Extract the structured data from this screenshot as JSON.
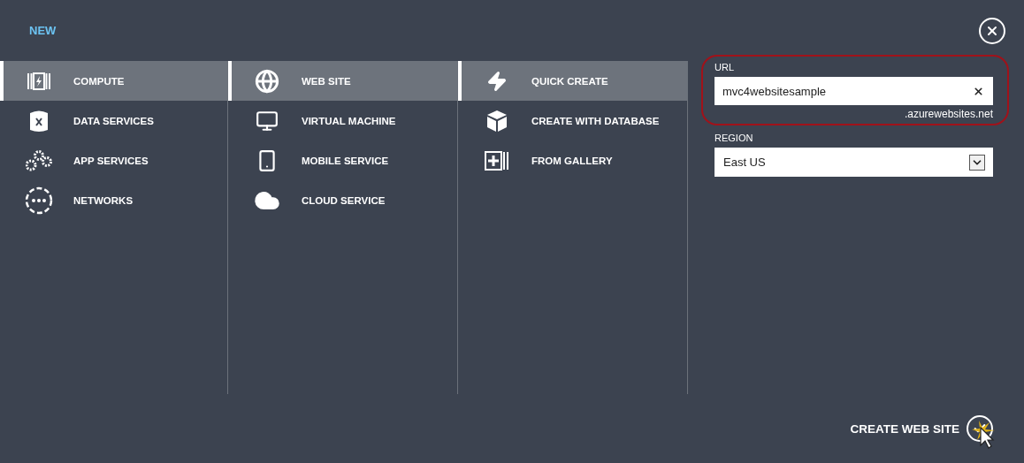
{
  "header": {
    "title": "NEW"
  },
  "columns": [
    {
      "items": [
        {
          "kind": "compute",
          "label": "COMPUTE",
          "selected": true
        },
        {
          "kind": "data",
          "label": "DATA SERVICES",
          "selected": false
        },
        {
          "kind": "app",
          "label": "APP SERVICES",
          "selected": false
        },
        {
          "kind": "network",
          "label": "NETWORKS",
          "selected": false
        }
      ]
    },
    {
      "items": [
        {
          "kind": "website",
          "label": "WEB SITE",
          "selected": true
        },
        {
          "kind": "vm",
          "label": "VIRTUAL MACHINE",
          "selected": false
        },
        {
          "kind": "mobile",
          "label": "MOBILE SERVICE",
          "selected": false
        },
        {
          "kind": "cloud",
          "label": "CLOUD SERVICE",
          "selected": false
        }
      ]
    },
    {
      "items": [
        {
          "kind": "quick",
          "label": "QUICK CREATE",
          "selected": true
        },
        {
          "kind": "database",
          "label": "CREATE WITH DATABASE",
          "selected": false
        },
        {
          "kind": "gallery",
          "label": "FROM GALLERY",
          "selected": false
        }
      ]
    }
  ],
  "form": {
    "url": {
      "label": "URL",
      "value": "mvc4websitesample",
      "suffix": ".azurewebsites.net",
      "highlighted": true
    },
    "region": {
      "label": "REGION",
      "value": "East US"
    }
  },
  "submit": {
    "label": "CREATE WEB SITE"
  }
}
